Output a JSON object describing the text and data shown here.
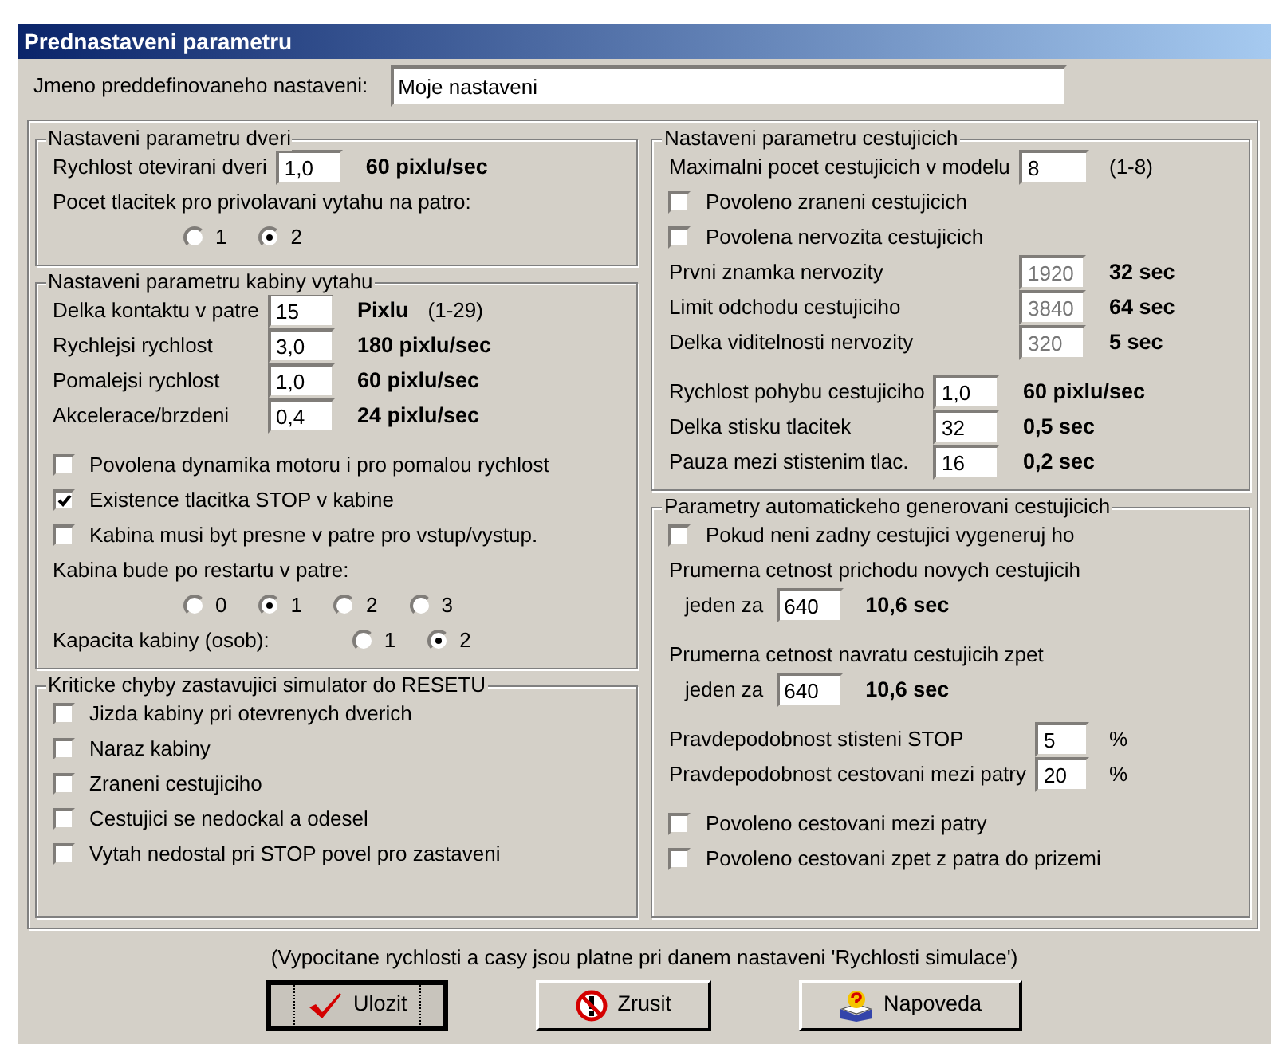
{
  "window": {
    "title": "Prednastaveni parametru"
  },
  "preset": {
    "label": "Jmeno preddefinovaneho nastaveni:",
    "value": "Moje nastaveni"
  },
  "columns": [
    [
      {
        "title": "Nastaveni parametru dveri",
        "sections": [
          [
            {
              "kind": "field",
              "label": "Rychlost otevirani dveri",
              "value": "1,0",
              "unit": "60 pixlu/sec",
              "disabled": false
            },
            {
              "kind": "text",
              "text": "Pocet tlacitek pro privolavani vytahu na patro:"
            },
            {
              "kind": "radios",
              "options": [
                {
                  "label": "1",
                  "selected": false
                },
                {
                  "label": "2",
                  "selected": true
                }
              ]
            }
          ]
        ]
      },
      {
        "title": "Nastaveni parametru kabiny vytahu",
        "sections": [
          [
            {
              "kind": "field",
              "label": "Delka kontaktu v patre",
              "value": "15",
              "unit": "Pixlu",
              "note": "(1-29)",
              "disabled": false
            },
            {
              "kind": "field",
              "label": "Rychlejsi rychlost",
              "value": "3,0",
              "unit": "180 pixlu/sec",
              "disabled": false
            },
            {
              "kind": "field",
              "label": "Pomalejsi rychlost",
              "value": "1,0",
              "unit": "60 pixlu/sec",
              "disabled": false
            },
            {
              "kind": "field",
              "label": "Akcelerace/brzdeni",
              "value": "0,4",
              "unit": "24 pixlu/sec",
              "disabled": false
            }
          ],
          [
            {
              "kind": "checkbox",
              "label": "Povolena dynamika motoru i pro pomalou rychlost",
              "checked": false
            },
            {
              "kind": "checkbox",
              "label": "Existence tlacitka STOP v kabine",
              "checked": true
            },
            {
              "kind": "checkbox",
              "label": "Kabina musi byt presne v patre pro vstup/vystup.",
              "checked": false
            },
            {
              "kind": "text",
              "text": "Kabina bude po restartu v patre:"
            },
            {
              "kind": "radios",
              "options": [
                {
                  "label": "0",
                  "selected": false
                },
                {
                  "label": "1",
                  "selected": true
                },
                {
                  "label": "2",
                  "selected": false
                },
                {
                  "label": "3",
                  "selected": false
                }
              ]
            },
            {
              "kind": "radios",
              "label": "Kapacita kabiny (osob):",
              "options": [
                {
                  "label": "1",
                  "selected": false
                },
                {
                  "label": "2",
                  "selected": true
                }
              ]
            }
          ]
        ]
      },
      {
        "title": "Kriticke chyby zastavujici simulator do RESETU",
        "sections": [
          [
            {
              "kind": "checkbox",
              "label": "Jizda kabiny pri otevrenych dverich",
              "checked": false
            },
            {
              "kind": "checkbox",
              "label": "Naraz kabiny",
              "checked": false
            },
            {
              "kind": "checkbox",
              "label": "Zraneni cestujiciho",
              "checked": false
            },
            {
              "kind": "checkbox",
              "label": "Cestujici se nedockal a odesel",
              "checked": false
            },
            {
              "kind": "checkbox",
              "label": "Vytah nedostal pri STOP povel pro zastaveni",
              "checked": false
            }
          ]
        ]
      }
    ],
    [
      {
        "title": "Nastaveni parametru cestujicich",
        "sections": [
          [
            {
              "kind": "field",
              "label": "Maximalni pocet cestujicich v modelu",
              "value": "8",
              "note": "(1-8)",
              "disabled": false
            },
            {
              "kind": "checkbox",
              "label": "Povoleno zraneni cestujicich",
              "checked": false
            },
            {
              "kind": "checkbox",
              "label": "Povolena nervozita cestujicich",
              "checked": false
            },
            {
              "kind": "field",
              "label": "Prvni znamka nervozity",
              "value": "1920",
              "unit": "32 sec",
              "disabled": true
            },
            {
              "kind": "field",
              "label": "Limit odchodu cestujiciho",
              "value": "3840",
              "unit": "64 sec",
              "disabled": true
            },
            {
              "kind": "field",
              "label": "Delka viditelnosti nervozity",
              "value": "320",
              "unit": "5 sec",
              "disabled": true
            }
          ],
          [
            {
              "kind": "field",
              "label": "Rychlost pohybu cestujiciho",
              "value": "1,0",
              "unit": "60 pixlu/sec",
              "disabled": false
            },
            {
              "kind": "field",
              "label": "Delka stisku tlacitek",
              "value": "32",
              "unit": "0,5 sec",
              "disabled": false
            },
            {
              "kind": "field",
              "label": "Pauza mezi stistenim tlac.",
              "value": "16",
              "unit": "0,2 sec",
              "disabled": false
            }
          ]
        ]
      },
      {
        "title": "Parametry automatickeho generovani cestujicich",
        "sections": [
          [
            {
              "kind": "checkbox",
              "label": "Pokud neni zadny cestujici vygeneruj ho",
              "checked": false
            },
            {
              "kind": "prompt",
              "text": "Prumerna cetnost prichodu novych cestujicih",
              "label": "jeden za",
              "value": "640",
              "unit": "10,6 sec",
              "disabled": false
            }
          ],
          [
            {
              "kind": "prompt",
              "text": "Prumerna cetnost navratu cestujicih zpet",
              "label": "jeden za",
              "value": "640",
              "unit": "10,6 sec",
              "disabled": false
            }
          ],
          [
            {
              "kind": "field",
              "label": "Pravdepodobnost stisteni STOP",
              "value": "5",
              "note": "%",
              "disabled": false
            },
            {
              "kind": "field",
              "label": "Pravdepodobnost cestovani mezi patry",
              "value": "20",
              "note": "%",
              "disabled": false
            }
          ],
          [
            {
              "kind": "checkbox",
              "label": "Povoleno cestovani mezi patry",
              "checked": false
            },
            {
              "kind": "checkbox",
              "label": "Povoleno cestovani zpet z patra do prizemi",
              "checked": false
            }
          ]
        ]
      }
    ]
  ],
  "footer_note": "(Vypocitane rychlosti a casy jsou platne pri danem nastaveni 'Rychlosti simulace')",
  "buttons": [
    {
      "label": "Ulozit",
      "focused": true
    },
    {
      "label": "Zrusit",
      "focused": false
    },
    {
      "label": "Napoveda",
      "focused": false
    }
  ]
}
